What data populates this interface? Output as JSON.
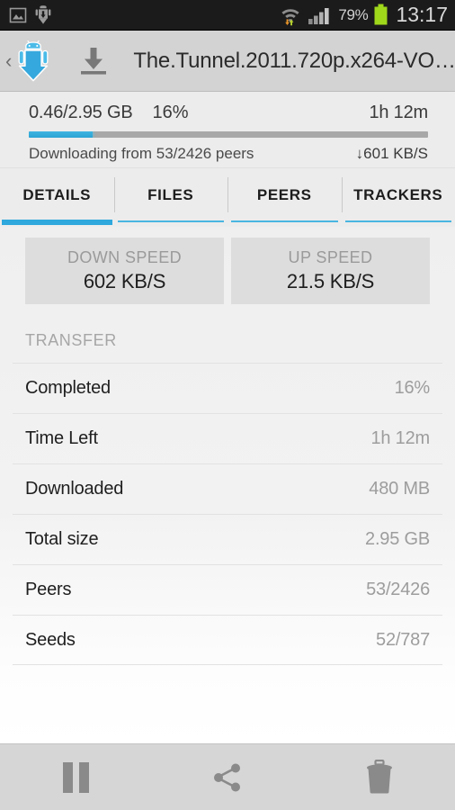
{
  "status_bar": {
    "notifications": [
      "image-icon",
      "android-download-icon"
    ],
    "wifi_icon": "wifi-transfer-icon",
    "signal_icon": "cellular-signal-icon",
    "battery_percent": "79%",
    "battery_icon": "battery-full-icon",
    "clock": "13:17"
  },
  "action_bar": {
    "up_caret": "‹",
    "app_icon": "android-download-app-icon",
    "download_icon": "download-icon",
    "title": "The.Tunnel.2011.720p.x264-VO…"
  },
  "progress": {
    "size": "0.46/2.95 GB",
    "percent": "16%",
    "eta": "1h 12m",
    "percent_value": 16,
    "status": "Downloading from 53/2426 peers",
    "speed": "↓601 KB/S",
    "fill_color": "#2aa3d4",
    "track_color": "#a8a8a8"
  },
  "tabs": [
    {
      "label": "DETAILS",
      "active": true
    },
    {
      "label": "FILES",
      "active": false
    },
    {
      "label": "PEERS",
      "active": false
    },
    {
      "label": "TRACKERS",
      "active": false
    }
  ],
  "speed_cards": [
    {
      "label": "DOWN SPEED",
      "value": "602 KB/S"
    },
    {
      "label": "UP SPEED",
      "value": "21.5 KB/S"
    }
  ],
  "transfer": {
    "header": "TRANSFER",
    "rows": [
      {
        "label": "Completed",
        "value": "16%"
      },
      {
        "label": "Time Left",
        "value": "1h 12m"
      },
      {
        "label": "Downloaded",
        "value": "480 MB"
      },
      {
        "label": "Total size",
        "value": "2.95 GB"
      },
      {
        "label": "Peers",
        "value": "53/2426"
      },
      {
        "label": "Seeds",
        "value": "52/787"
      }
    ]
  },
  "bottom_bar": {
    "buttons": [
      {
        "name": "pause-button",
        "icon": "pause-icon"
      },
      {
        "name": "share-button",
        "icon": "share-icon"
      },
      {
        "name": "delete-button",
        "icon": "trash-icon"
      }
    ]
  },
  "colors": {
    "accent": "#2aa3d4",
    "action_bar": "#d3d3d3",
    "status_bar": "#1b1b1b",
    "battery_green": "#9fd71b"
  }
}
